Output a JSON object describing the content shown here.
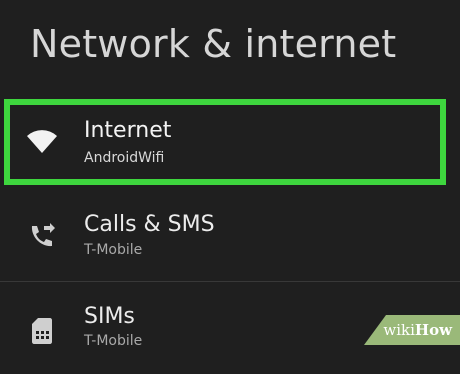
{
  "header": {
    "title": "Network & internet"
  },
  "settings": {
    "items": [
      {
        "label": "Internet",
        "summary": "AndroidWifi",
        "icon": "wifi-icon",
        "highlighted": true
      },
      {
        "label": "Calls & SMS",
        "summary": "T-Mobile",
        "icon": "phone-forward-icon",
        "highlighted": false
      },
      {
        "label": "SIMs",
        "summary": "T-Mobile",
        "icon": "sim-card-icon",
        "highlighted": false
      }
    ]
  },
  "colors": {
    "background": "#1f1f1f",
    "highlight": "#3ed63e",
    "watermark": "#9ab979"
  },
  "watermark": {
    "prefix": "wiki",
    "brand": "How"
  }
}
